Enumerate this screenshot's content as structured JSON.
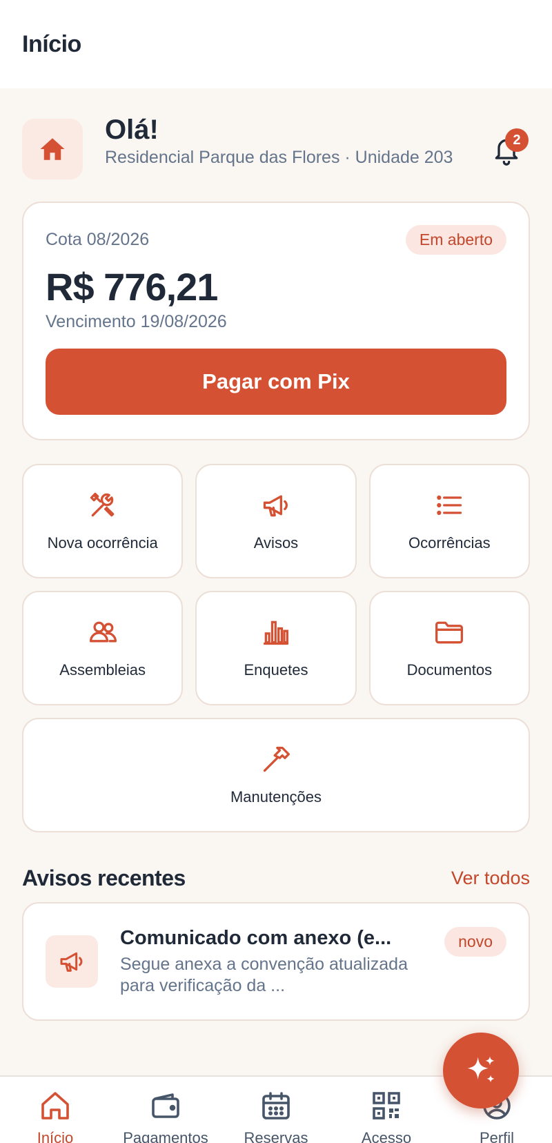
{
  "topbar": {
    "title": "Início"
  },
  "greeting": {
    "title": "Olá!",
    "subtitle": "Residencial Parque das Flores · Unidade 203",
    "notification_count": "2"
  },
  "payment": {
    "period": "Cota 08/2026",
    "status": "Em aberto",
    "amount": "R$ 776,21",
    "due": "Vencimento 19/08/2026",
    "pay_button": "Pagar com Pix"
  },
  "shortcuts": [
    {
      "label": "Nova ocorrência",
      "icon": "tools-icon"
    },
    {
      "label": "Avisos",
      "icon": "megaphone-icon"
    },
    {
      "label": "Ocorrências",
      "icon": "list-icon"
    },
    {
      "label": "Assembleias",
      "icon": "users-icon"
    },
    {
      "label": "Enquetes",
      "icon": "bar-chart-icon"
    },
    {
      "label": "Documentos",
      "icon": "folder-icon"
    },
    {
      "label": "Manutenções",
      "icon": "hammer-icon"
    }
  ],
  "recent_notices": {
    "title": "Avisos recentes",
    "see_all": "Ver todos",
    "items": [
      {
        "title": "Comunicado com anexo (e...",
        "body": "Segue anexa a convenção atualizada para verificação da ...",
        "badge": "novo"
      }
    ]
  },
  "bottom_nav": [
    {
      "label": "Início",
      "icon": "home-icon",
      "active": true
    },
    {
      "label": "Pagamentos",
      "icon": "wallet-icon",
      "active": false
    },
    {
      "label": "Reservas",
      "icon": "calendar-icon",
      "active": false
    },
    {
      "label": "Acesso",
      "icon": "qr-code-icon",
      "active": false
    },
    {
      "label": "Perfil",
      "icon": "profile-icon",
      "active": false
    }
  ],
  "colors": {
    "accent": "#d45133",
    "accent_soft": "#fbe9e4",
    "background": "#faf6f2",
    "text": "#1f2937",
    "muted": "#64748b"
  }
}
